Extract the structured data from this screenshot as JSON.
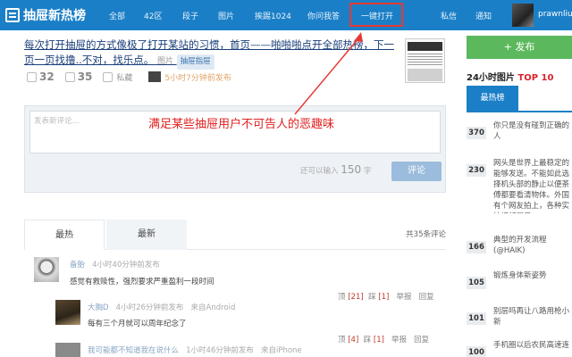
{
  "nav": {
    "logo": "抽屉新热榜",
    "items": [
      "全部",
      "42区",
      "段子",
      "图片",
      "挨踢1024",
      "你问我答",
      "一键打开"
    ],
    "right": [
      "私信",
      "通知"
    ],
    "username": "prawnliu"
  },
  "article": {
    "title": "每次打开抽屉的方式像极了打开某站的习惯，首页——啪啪啪点开全部热榜，下一页一页找撸..不对，找乐点。",
    "source": "图片",
    "tag": "抽屉指屉",
    "likes": "32",
    "comments": "35",
    "save": "私藏",
    "time": "5小时7分钟前发布"
  },
  "comment_box": {
    "placeholder": "发表新评论...",
    "remain_prefix": "还可以输入",
    "remain_num": "150",
    "remain_suffix": "字",
    "submit": "评论"
  },
  "annotation": "满足某些抽屉用户不可告人的恶趣味",
  "tabs": {
    "hot": "最热",
    "new": "最新",
    "total": "共35条评论"
  },
  "comments": [
    {
      "name": "备胎",
      "info": "4小时40分钟前发布",
      "text": "感觉有救赎性，强烈要求严重盈利一段时间",
      "acts": [
        "顶",
        "[21]",
        "踩",
        "[1]",
        "举报",
        "回复"
      ]
    },
    {
      "name": "大胸D",
      "info": "4小时26分钟前发布",
      "from": "来自Android",
      "text": "每有三个月就可以周年纪念了",
      "acts": [
        "顶",
        "[4]",
        "踩",
        "[1]",
        "举报",
        "回复"
      ]
    },
    {
      "name": "我可能都不知道我在说什么",
      "info": "1小时46分钟前发布",
      "from": "来自iPhone"
    }
  ],
  "sidebar": {
    "post": "+ 发布",
    "title_prefix": "24小时图片",
    "title_top": "TOP 10",
    "tab": "最热榜",
    "ranks": [
      {
        "num": "370",
        "text": "你只是没有碰到正确的人"
      },
      {
        "num": "230",
        "text": "网头是世界上最稳定的能够发送。不能如此选择机头部的静止以便茶傅都要看清物体。外国有个网友拍上，各种实拍视频展示"
      },
      {
        "num": "166",
        "text": "典型的开发流程 (@HAIK)"
      },
      {
        "num": "105",
        "text": "锻炼身体新姿势"
      },
      {
        "num": "101",
        "text": "别层吗再让八路用枪小新"
      },
      {
        "num": "100",
        "text": "手机圈以后农民高速连"
      }
    ]
  }
}
